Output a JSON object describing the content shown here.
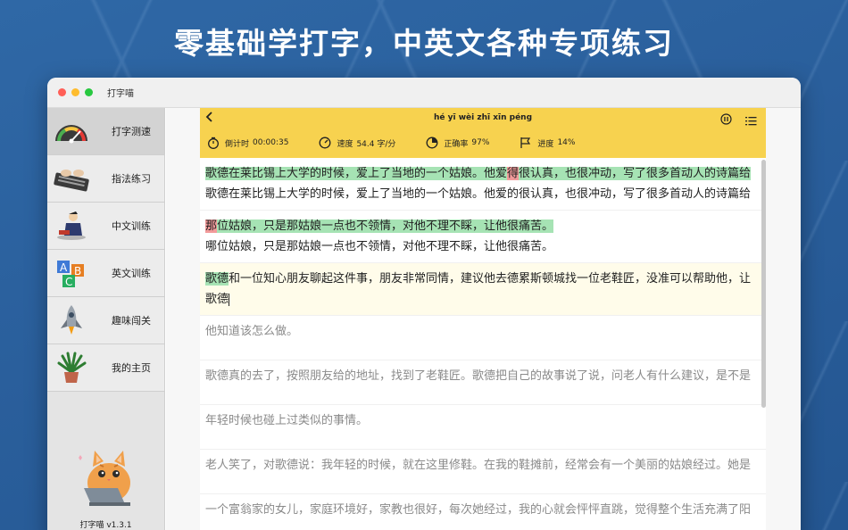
{
  "headline": "零基础学打字，中英文各种专项练习",
  "window": {
    "title": "打字喵"
  },
  "sidebar": {
    "items": [
      {
        "label": "打字测速",
        "icon": "speedometer-icon",
        "active": true
      },
      {
        "label": "指法练习",
        "icon": "keyboard-icon",
        "active": false
      },
      {
        "label": "中文训练",
        "icon": "reading-person-icon",
        "active": false
      },
      {
        "label": "英文训练",
        "icon": "abc-blocks-icon",
        "active": false
      },
      {
        "label": "趣味闯关",
        "icon": "rocket-icon",
        "active": false
      },
      {
        "label": "我的主页",
        "icon": "plant-icon",
        "active": false
      }
    ],
    "mascot_icon": "cat-laptop-icon",
    "version": "打字喵 v1.3.1"
  },
  "practice": {
    "pinyin": "hé yī wèi zhī xīn péng",
    "stats": {
      "timer_label": "倒计时",
      "timer_value": "00:00:35",
      "speed_label": "速度",
      "speed_value": "54.4 字/分",
      "accuracy_label": "正确率",
      "accuracy_value": "97%",
      "progress_label": "进度",
      "progress_value": "14%"
    },
    "paragraphs": [
      {
        "source_segments": [
          {
            "text": "歌德在莱比锡上大学的时候，爱上了当地的一个姑娘。他爱",
            "state": "ok"
          },
          {
            "text": "得",
            "state": "err"
          },
          {
            "text": "很认真，也很冲动，写了很多首动人的诗篇给",
            "state": "ok"
          }
        ],
        "typed": "歌德在莱比锡上大学的时候，爱上了当地的一个姑娘。他爱的很认真，也很冲动，写了很多首动人的诗篇给"
      },
      {
        "source_segments": [
          {
            "text": "那",
            "state": "err"
          },
          {
            "text": "位姑娘，只是那姑娘一点也不领情，对他不理不睬，让他很痛苦。",
            "state": "ok"
          }
        ],
        "typed": "哪位姑娘，只是那姑娘一点也不领情，对他不理不睬，让他很痛苦。"
      },
      {
        "source_segments": [
          {
            "text": "歌德",
            "state": "ok"
          },
          {
            "text": "和一位知心朋友聊起这件事，朋友非常同情，建议他去德累斯顿城找一位老鞋匠，没准可以帮助他，让",
            "state": "none"
          }
        ],
        "typed": "歌德"
      }
    ],
    "pending_lines": [
      "他知道该怎么做。",
      "歌德真的去了，按照朋友给的地址，找到了老鞋匠。歌德把自己的故事说了说，问老人有什么建议，是不是",
      "年轻时候也碰上过类似的事情。",
      "老人笑了，对歌德说：我年轻的时候，就在这里修鞋。在我的鞋摊前，经常会有一个美丽的姑娘经过。她是",
      "一个富翁家的女儿，家庭环境好，家教也很好，每次她经过，我的心就会怦怦直跳，觉得整个生活充满了阳"
    ]
  }
}
